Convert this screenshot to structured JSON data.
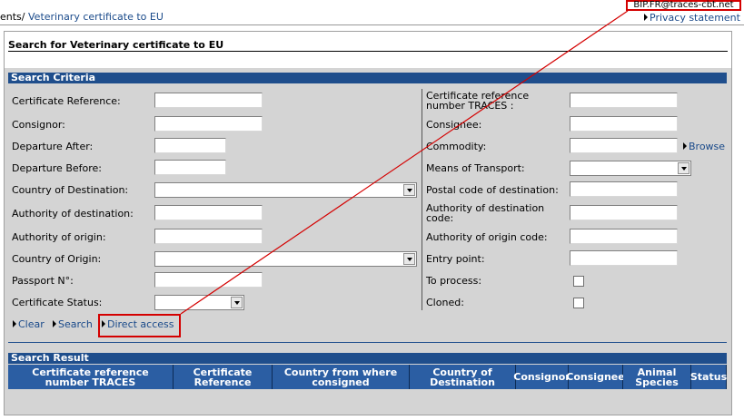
{
  "header": {
    "breadcrumb_prefix": "ents/",
    "breadcrumb_link": "Veterinary certificate to EU",
    "user_email": "BIP.FR@traces-cbt.net",
    "privacy_link": "Privacy statement"
  },
  "page": {
    "title": "Search for Veterinary certificate to EU",
    "criteria_title": "Search Criteria",
    "result_title": "Search Result"
  },
  "left_fields": [
    {
      "label": "Certificate Reference:"
    },
    {
      "label": "Consignor:"
    },
    {
      "label": "Departure After:"
    },
    {
      "label": "Departure Before:"
    },
    {
      "label": "Country of Destination:"
    },
    {
      "label": "Authority of destination:"
    },
    {
      "label": "Authority of origin:"
    },
    {
      "label": "Country of Origin:"
    },
    {
      "label": "Passport N°:"
    },
    {
      "label": "Certificate Status:"
    }
  ],
  "right_fields": [
    {
      "label": "Certificate reference number TRACES :"
    },
    {
      "label": "Consignee:"
    },
    {
      "label": "Commodity:"
    },
    {
      "label": "Means of Transport:"
    },
    {
      "label": "Postal code of destination:"
    },
    {
      "label": "Authority of destination code:"
    },
    {
      "label": "Authority of origin code:"
    },
    {
      "label": "Entry point:"
    },
    {
      "label": "To process:"
    },
    {
      "label": "Cloned:"
    }
  ],
  "actions": {
    "browse": "Browse",
    "clear": "Clear",
    "search": "Search",
    "direct_access": "Direct access"
  },
  "result_columns": [
    "Certificate reference number TRACES",
    "Certificate Reference",
    "Country from where consigned",
    "Country of Destination",
    "Consignor",
    "Consignee",
    "Animal Species",
    "Status"
  ],
  "colors": {
    "section_bar": "#1f4e8c",
    "highlight": "#d40000",
    "panel": "#d4d4d4"
  }
}
